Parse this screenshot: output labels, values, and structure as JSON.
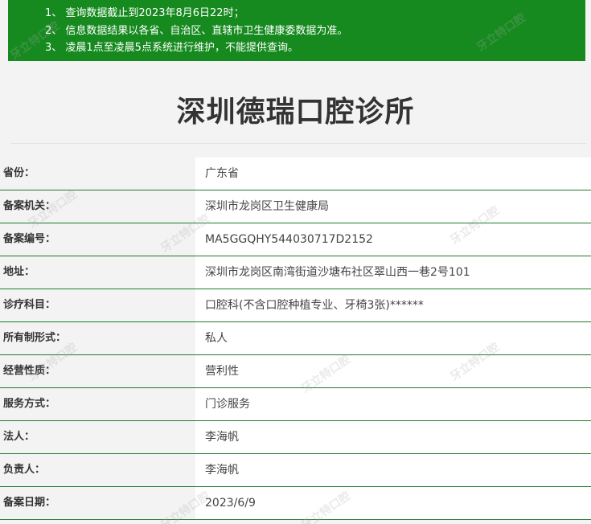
{
  "notice": {
    "items": [
      "1、 查询数据截止到2023年8月6日22时；",
      "2、 信息数据结果以各省、自治区、直辖市卫生健康委数据为准。",
      "3、 凌晨1点至凌晨5点系统进行维护，不能提供查询。"
    ]
  },
  "title": "深圳德瑞口腔诊所",
  "rows": [
    {
      "label": "省份：",
      "value": "广东省"
    },
    {
      "label": "备案机关：",
      "value": "深圳市龙岗区卫生健康局"
    },
    {
      "label": "备案编号：",
      "value": "MA5GGQHY544030717D2152"
    },
    {
      "label": "地址：",
      "value": "深圳市龙岗区南湾街道沙塘布社区翠山西一巷2号101"
    },
    {
      "label": "诊疗科目：",
      "value": "口腔科(不含口腔种植专业、牙椅3张)******"
    },
    {
      "label": "所有制形式：",
      "value": "私人"
    },
    {
      "label": "经营性质：",
      "value": "营利性"
    },
    {
      "label": "服务方式：",
      "value": "门诊服务"
    },
    {
      "label": "法人：",
      "value": "李海帆"
    },
    {
      "label": "负责人：",
      "value": "李海帆"
    },
    {
      "label": "备案日期：",
      "value": "2023/6/9"
    }
  ],
  "watermark": "牙立特口腔",
  "colors": {
    "notice_bg": "#168a1f",
    "row_border": "#1e7b2c"
  }
}
